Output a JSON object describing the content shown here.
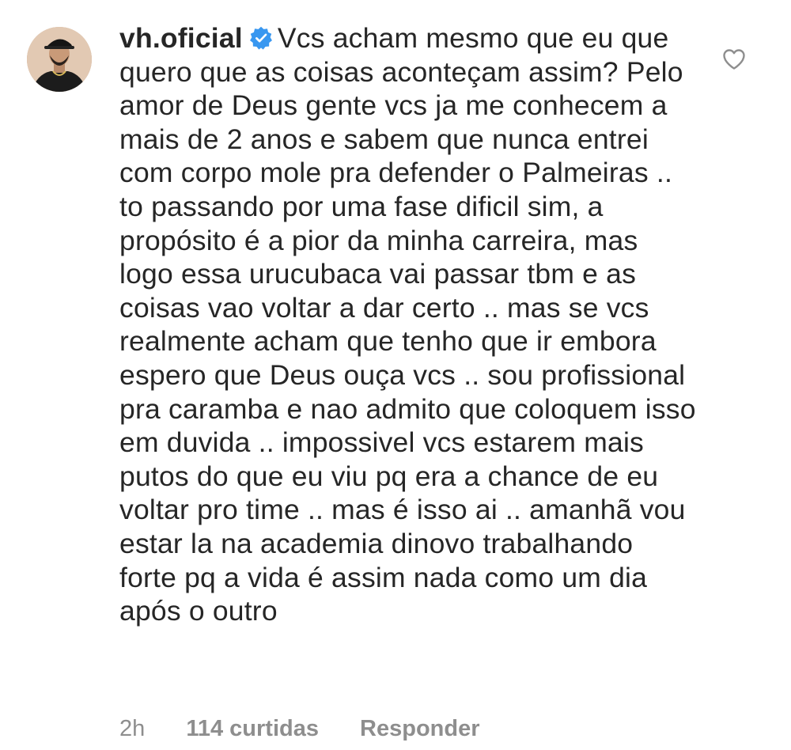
{
  "comment": {
    "username": "vh.oficial",
    "verified": true,
    "text": "Vcs acham mesmo que eu que quero que as coisas aconteçam assim? Pelo amor de Deus gente vcs ja me conhecem a mais de 2 anos e sabem que nunca entrei com corpo mole pra defender o Palmeiras .. to passando por uma fase dificil sim, a propósito é a pior da minha carreira, mas logo essa urucubaca vai passar tbm e as coisas vao voltar a dar certo .. mas se vcs realmente acham que tenho que ir embora espero que Deus ouça vcs .. sou profissional pra caramba e nao admito que coloquem isso em duvida .. impossivel vcs estarem mais putos do que eu viu pq era a chance de eu voltar pro time .. mas é isso ai .. amanhã vou estar la na academia dinovo trabalhando forte pq a vida é assim nada como um dia após o outro",
    "time": "2h",
    "likes": "114 curtidas",
    "reply_label": "Responder"
  },
  "icons": {
    "verified": "verified-badge-icon",
    "like": "heart-outline-icon",
    "avatar": "profile-avatar"
  },
  "colors": {
    "text": "#262626",
    "meta": "#8e8e8e",
    "verified_badge": "#3897f0"
  }
}
